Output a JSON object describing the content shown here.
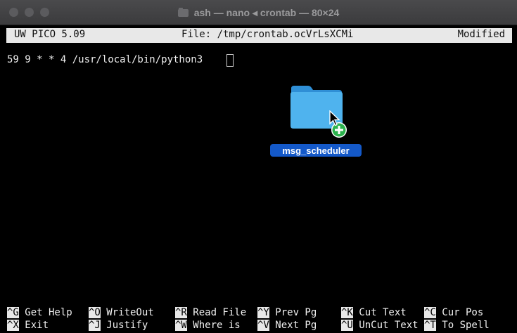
{
  "window": {
    "title": "ash — nano ◂ crontab — 80×24"
  },
  "nano": {
    "version": "UW PICO 5.09",
    "file": "File: /tmp/crontab.ocVrLsXCMi",
    "status": "Modified"
  },
  "editor": {
    "line1": "59 9 * * 4 /usr/local/bin/python3 "
  },
  "drag": {
    "folder_name": "msg_scheduler",
    "folder_color": "#3fa9e8",
    "badge_color": "#2bb24c",
    "label_color": "#1459c9"
  },
  "shortcuts": {
    "row1": [
      {
        "key": "^G",
        "label": " Get Help"
      },
      {
        "key": "^O",
        "label": " WriteOut"
      },
      {
        "key": "^R",
        "label": " Read File"
      },
      {
        "key": "^Y",
        "label": " Prev Pg"
      },
      {
        "key": "^K",
        "label": " Cut Text"
      },
      {
        "key": "^C",
        "label": " Cur Pos"
      }
    ],
    "row2": [
      {
        "key": "^X",
        "label": " Exit"
      },
      {
        "key": "^J",
        "label": " Justify"
      },
      {
        "key": "^W",
        "label": " Where is"
      },
      {
        "key": "^V",
        "label": " Next Pg"
      },
      {
        "key": "^U",
        "label": " UnCut Text"
      },
      {
        "key": "^T",
        "label": " To Spell"
      }
    ]
  }
}
